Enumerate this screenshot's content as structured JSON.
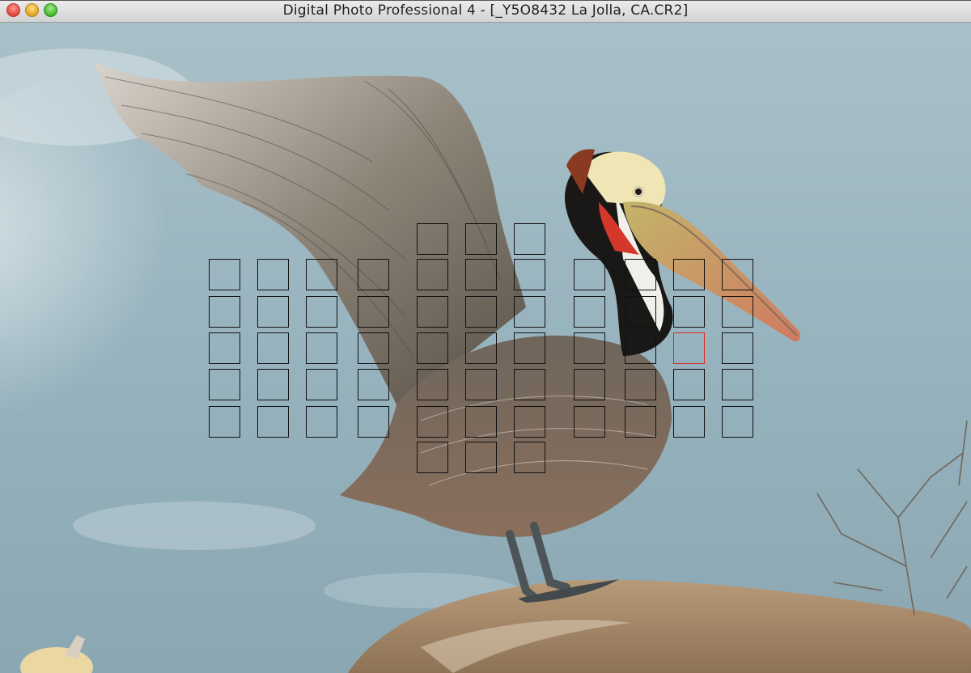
{
  "window": {
    "title": "Digital Photo Professional 4 - [_Y5O8432 La Jolla, CA.CR2]",
    "controls": [
      "close-icon",
      "minimize-icon",
      "zoom-icon"
    ]
  },
  "image_viewer": {
    "af_points": {
      "selected": "row-3-col-10",
      "colors": {
        "frame": "#111111",
        "selected": "#e02a1e"
      }
    }
  }
}
